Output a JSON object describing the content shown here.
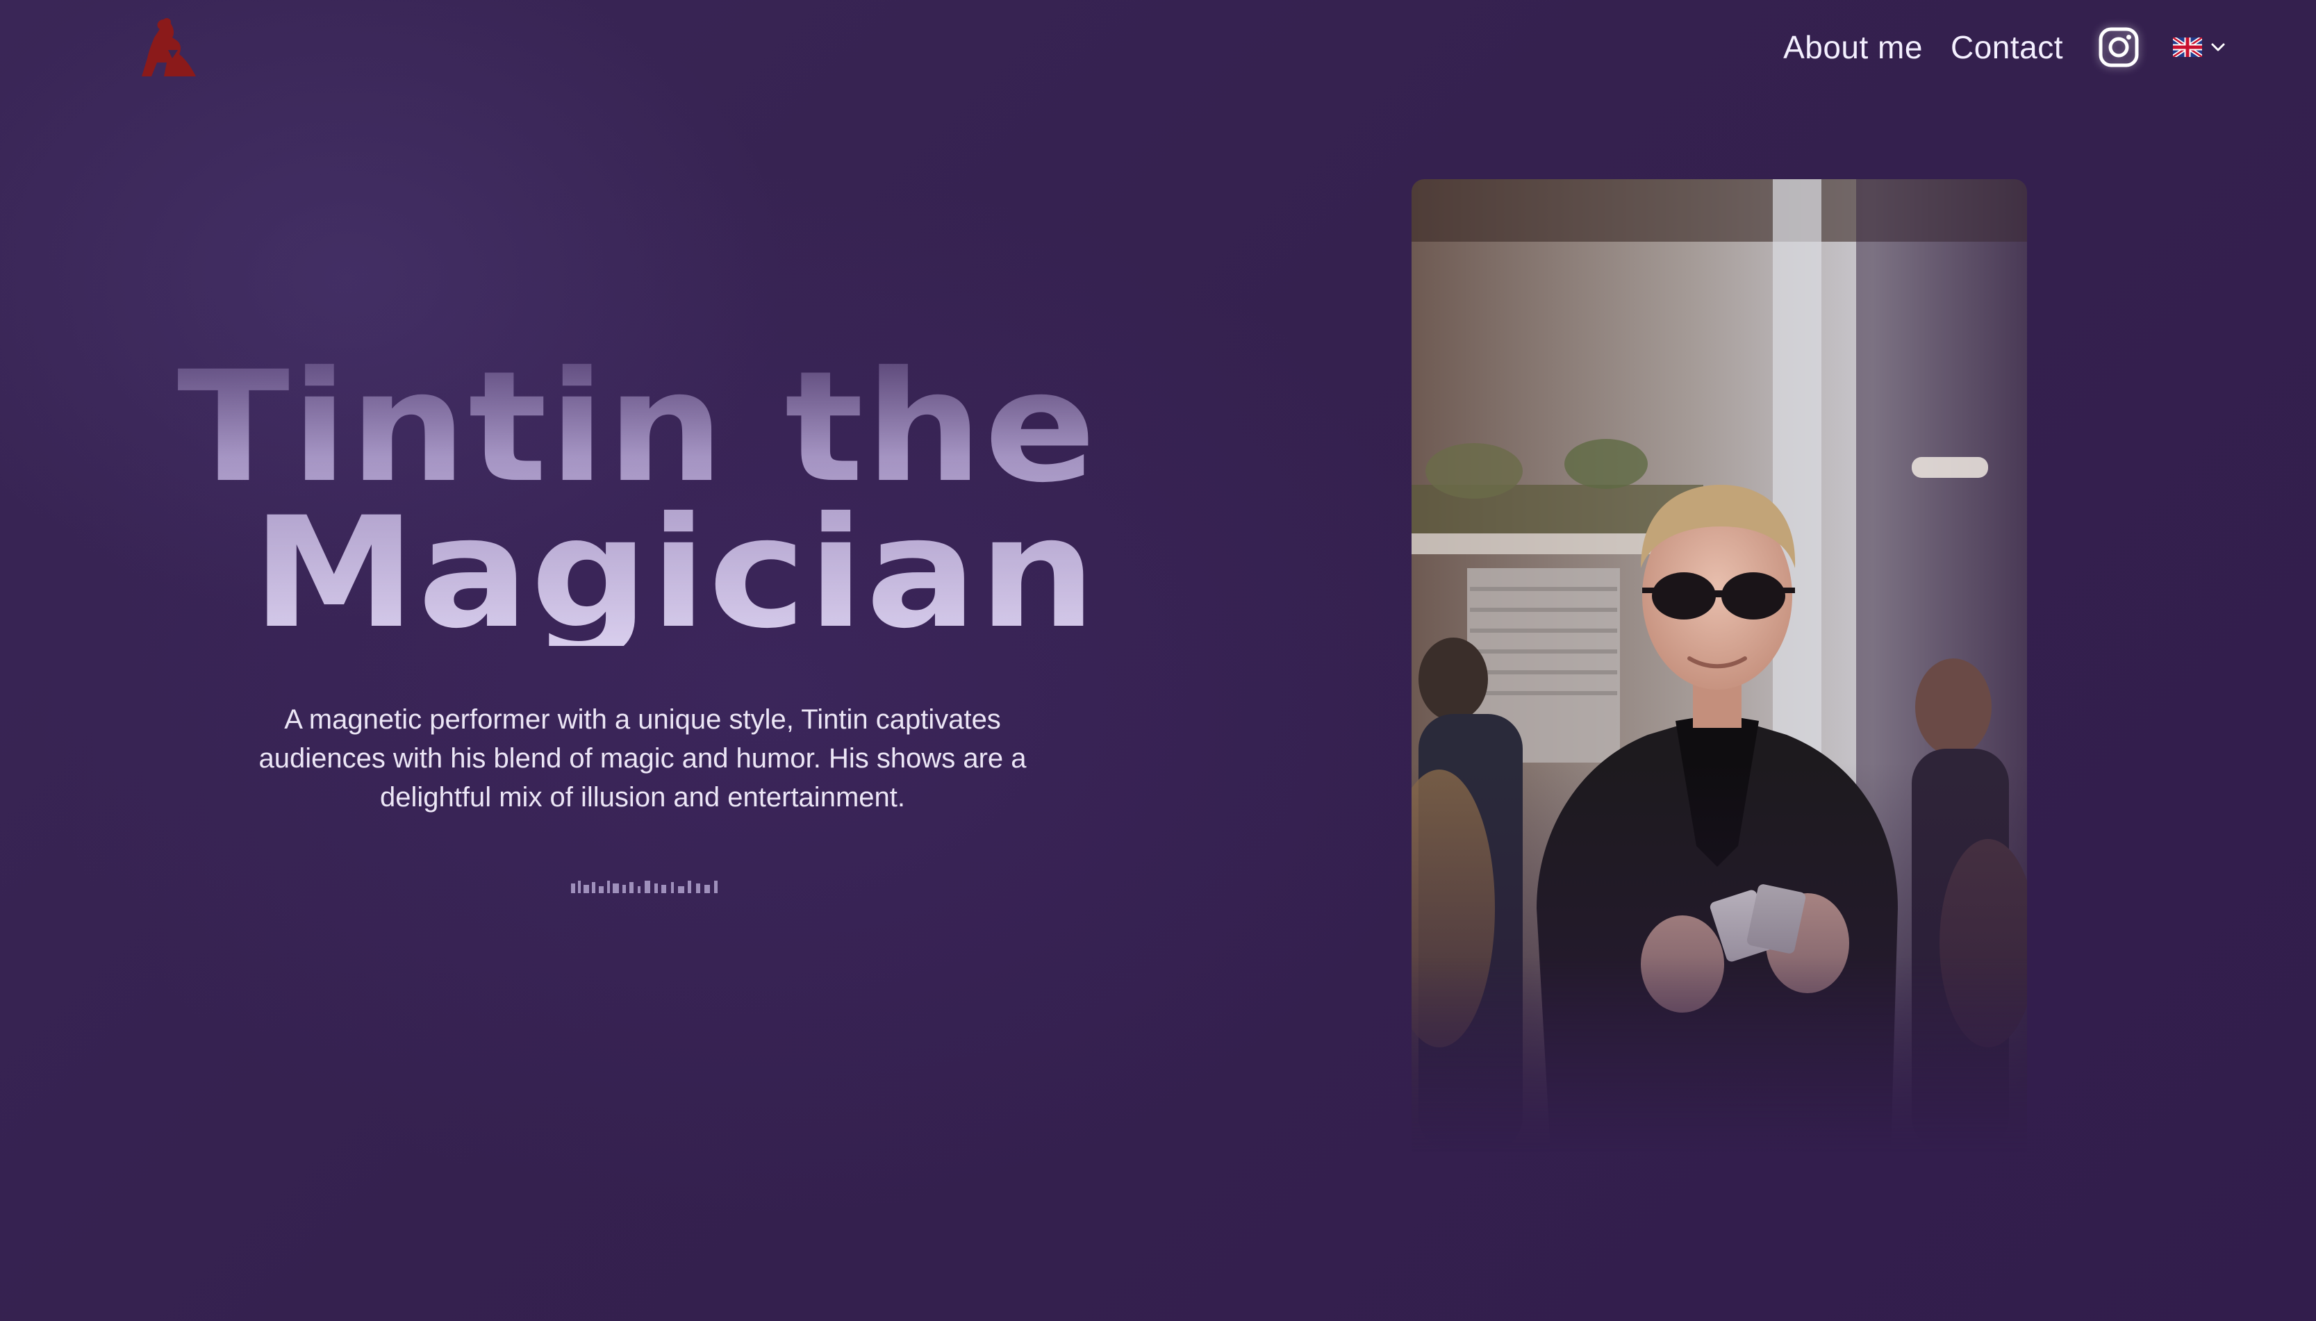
{
  "header": {
    "logo_icon": "magician-hat-logo-icon",
    "nav": {
      "about_label": "About me",
      "contact_label": "Contact",
      "instagram_icon": "instagram-icon",
      "language_icon": "uk-flag-icon",
      "language_chevron_icon": "chevron-down-icon"
    }
  },
  "hero": {
    "title_line1": "Tintin the",
    "title_line2": "Magician",
    "description": "A magnetic performer with a unique style, Tintin captivates audiences with his blend of magic and humor. His shows are a delightful mix of illusion and entertainment."
  },
  "photo": {
    "subject_icon": "magician-portrait-photo"
  },
  "colors": {
    "background": "#35214f",
    "logo_red": "#8b1a1a",
    "text": "#f4f0ff"
  }
}
